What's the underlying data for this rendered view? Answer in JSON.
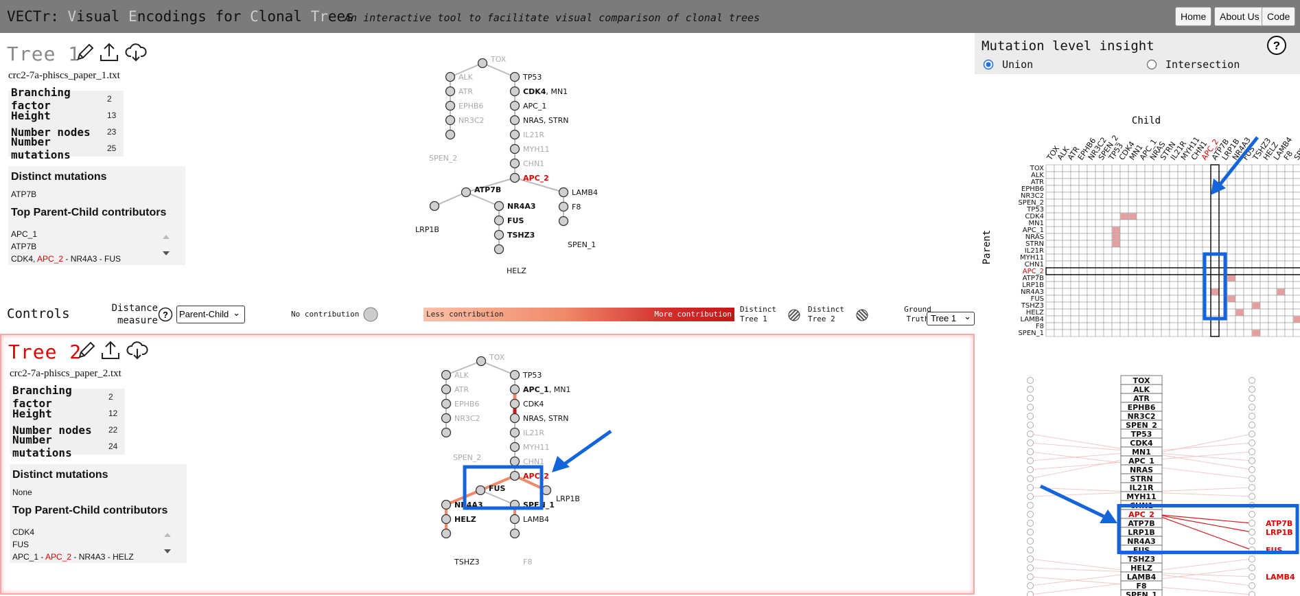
{
  "app": {
    "title_parts": [
      {
        "t": "VECTr: ",
        "dim": false
      },
      {
        "t": "V",
        "dim": true
      },
      {
        "t": "isual ",
        "dim": false
      },
      {
        "t": "E",
        "dim": true
      },
      {
        "t": "ncodings for ",
        "dim": false
      },
      {
        "t": "C",
        "dim": true
      },
      {
        "t": "lonal ",
        "dim": false
      },
      {
        "t": "T",
        "dim": true
      },
      {
        "t": "r",
        "dim": true
      },
      {
        "t": "ees",
        "dim": false
      }
    ],
    "subtitle": "An interactive tool to facilitate visual comparison of clonal trees",
    "nav": {
      "home": "Home",
      "about": "About Us",
      "code": "Code"
    }
  },
  "tree1": {
    "title": "Tree 1",
    "file": "crc2-7a-phiscs_paper_1.txt",
    "stats": [
      {
        "label": "Branching factor",
        "value": "2"
      },
      {
        "label": "Height",
        "value": "13"
      },
      {
        "label": "Number nodes",
        "value": "23"
      },
      {
        "label": "Number mutations",
        "value": "25"
      }
    ],
    "distinct_heading": "Distinct mutations",
    "distinct_text": "ATP7B",
    "contrib_heading": "Top Parent-Child contributors",
    "contrib": [
      "APC_1",
      "ATP7B"
    ],
    "contrib_cut": [
      {
        "t": "CDK4, ",
        "red": false
      },
      {
        "t": "APC_2",
        "red": true
      },
      {
        "t": " - NR4A3 - FUS",
        "red": false
      }
    ]
  },
  "tree2": {
    "title": "Tree 2",
    "file": "crc2-7a-phiscs_paper_2.txt",
    "stats": [
      {
        "label": "Branching factor",
        "value": "2"
      },
      {
        "label": "Height",
        "value": "12"
      },
      {
        "label": "Number nodes",
        "value": "22"
      },
      {
        "label": "Number mutations",
        "value": "24"
      }
    ],
    "distinct_heading": "Distinct mutations",
    "distinct_text": "None",
    "contrib_heading": "Top Parent-Child contributors",
    "contrib": [
      "CDK4",
      "FUS"
    ],
    "contrib_cut": [
      {
        "t": "APC_1 - ",
        "red": false
      },
      {
        "t": "APC_2",
        "red": true
      },
      {
        "t": " - NR4A3 - HELZ",
        "red": false
      }
    ]
  },
  "controls": {
    "title": "Controls",
    "distance_label": "Distance measure",
    "distance_value": "Parent-Child",
    "no_contribution": "No contribution",
    "less_contribution": "Less contribution",
    "more_contribution": "More contribution",
    "distinct_t1": "Distinct Tree 1",
    "distinct_t2": "Distinct Tree 2",
    "ground_truth": "Ground Truth",
    "ground_truth_value": "Tree 1"
  },
  "insight": {
    "title": "Mutation level insight",
    "union": "Union",
    "intersection": "Intersection",
    "help": "?",
    "child_label": "Child",
    "parent_label": "Parent",
    "matrix_labels": [
      "TOX",
      "ALK",
      "ATR",
      "EPHB6",
      "NR3C2",
      "SPEN_2",
      "TP53",
      "CDK4",
      "MN1",
      "APC_1",
      "NRAS",
      "STRN",
      "IL21R",
      "MYH11",
      "CHN1",
      "APC_2",
      "ATP7B",
      "LRP1B",
      "NR4A3",
      "FUS",
      "TSHZ3",
      "HELZ",
      "LAMB4",
      "F8",
      "SPEN_1"
    ],
    "highlight_label": "APC_2",
    "filled_cells": [
      [
        7,
        9
      ],
      [
        7,
        10
      ],
      [
        9,
        8
      ],
      [
        10,
        8
      ],
      [
        11,
        8
      ],
      [
        16,
        22
      ],
      [
        18,
        20
      ],
      [
        18,
        28
      ],
      [
        19,
        22
      ],
      [
        20,
        25
      ],
      [
        21,
        23
      ],
      [
        22,
        30
      ],
      [
        24,
        25
      ]
    ],
    "mutation_list": [
      "TOX",
      "ALK",
      "ATR",
      "EPHB6",
      "NR3C2",
      "SPEN_2",
      "TP53",
      "CDK4",
      "MN1",
      "APC_1",
      "NRAS",
      "STRN",
      "IL21R",
      "MYH11",
      "CHN1",
      "APC_2",
      "ATP7B",
      "LRP1B",
      "NR4A3",
      "FUS",
      "TSHZ3",
      "HELZ",
      "LAMB4",
      "F8",
      "SPEN_1"
    ],
    "right_labels": [
      {
        "name": "ATP7B",
        "row": 16
      },
      {
        "name": "LRP1B",
        "row": 17
      },
      {
        "name": "FUS",
        "row": 19
      },
      {
        "name": "LAMB4",
        "row": 22
      }
    ],
    "colors": {
      "red": "#e00000",
      "pink": "#e4a0a0",
      "blue": "#1464dc",
      "orange": "#f0906a"
    }
  }
}
